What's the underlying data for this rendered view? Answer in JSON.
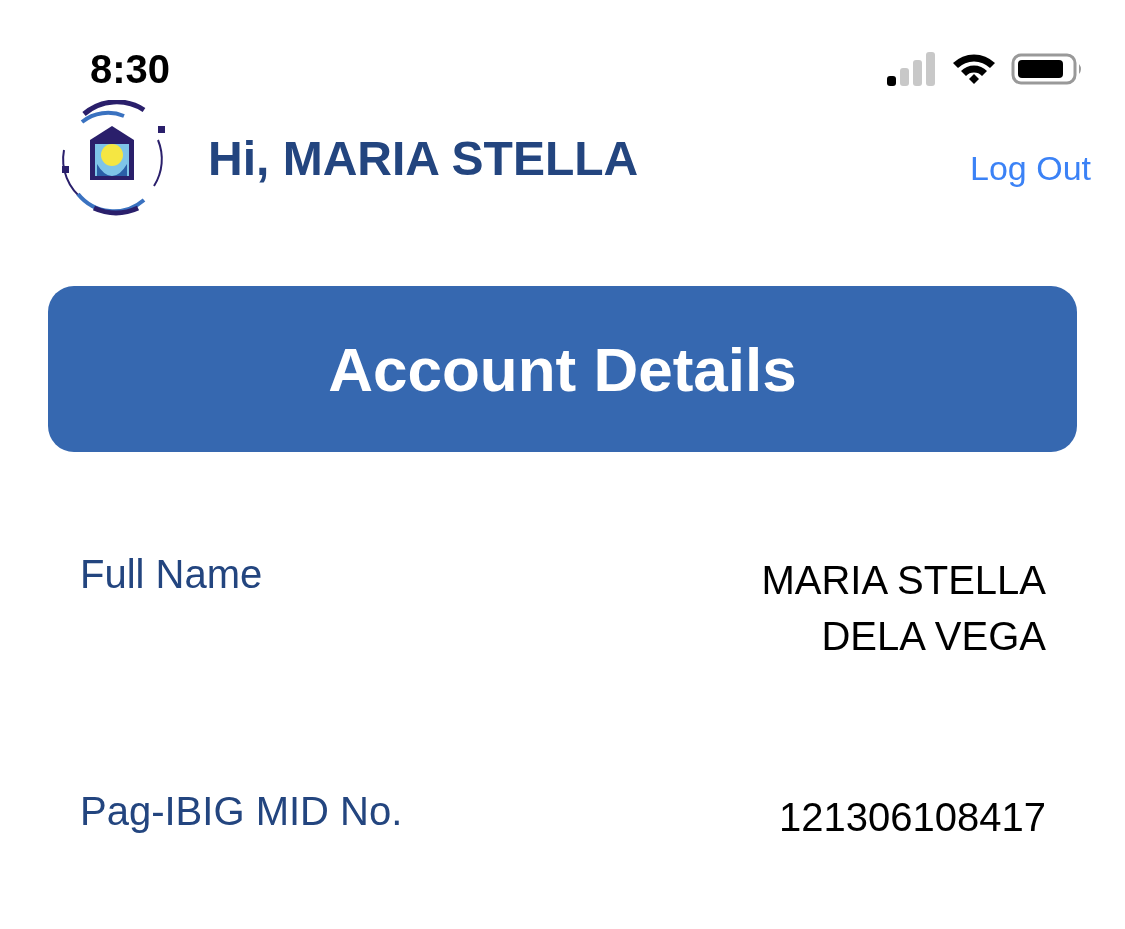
{
  "status_bar": {
    "time": "8:30"
  },
  "header": {
    "greeting": "Hi,",
    "name": "MARIA STELLA",
    "logout": "Log Out"
  },
  "title_button": {
    "label": "Account Details"
  },
  "details": [
    {
      "label": "Full Name",
      "value": "MARIA STELLA DELA VEGA"
    },
    {
      "label": "Pag-IBIG MID No.",
      "value": "121306108417"
    }
  ]
}
